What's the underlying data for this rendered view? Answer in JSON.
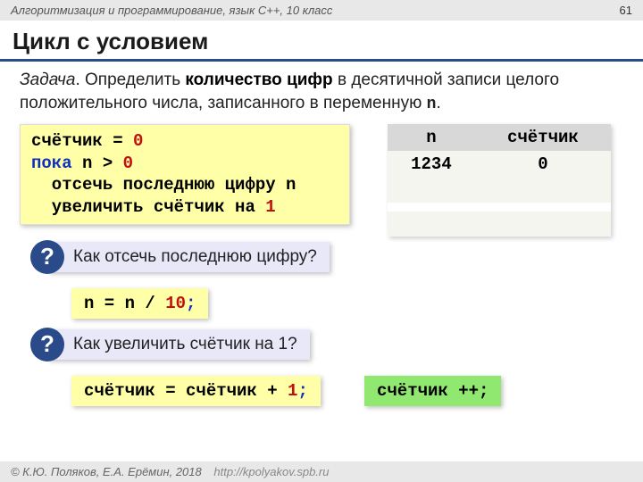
{
  "header": {
    "course": "Алгоритмизация и программирование, язык  C++, 10 класс",
    "page": "61"
  },
  "title": "Цикл с условием",
  "task": {
    "label": "Задача",
    "text1": ". Определить ",
    "bold": "количество цифр",
    "text2": " в десятичной записи целого положительного числа, записанного в переменную ",
    "var": "n",
    "text3": "."
  },
  "code": {
    "l1a": "счётчик = ",
    "l1b": "0",
    "l2a": "пока",
    "l2b": " n > ",
    "l2c": "0",
    "l3": "  отсечь последнюю цифру n",
    "l4a": "  увеличить счётчик на ",
    "l4b": "1"
  },
  "table": {
    "h1": "n",
    "h2": "счётчик",
    "r1c1": "1234",
    "r1c2": "0"
  },
  "q1": {
    "mark": "?",
    "text": "Как отсечь последнюю цифру?"
  },
  "snippet1": {
    "a": "n = n / ",
    "b": "10",
    "c": ";"
  },
  "q2": {
    "mark": "?",
    "text": "Как увеличить счётчик на 1?"
  },
  "snippet2": {
    "a": "счётчик = счётчик + ",
    "b": "1",
    "c": ";"
  },
  "snippet3": {
    "a": "счётчик ++;"
  },
  "footer": {
    "copyright": "© К.Ю. Поляков, Е.А. Ерёмин, 2018",
    "url": "http://kpolyakov.spb.ru"
  }
}
